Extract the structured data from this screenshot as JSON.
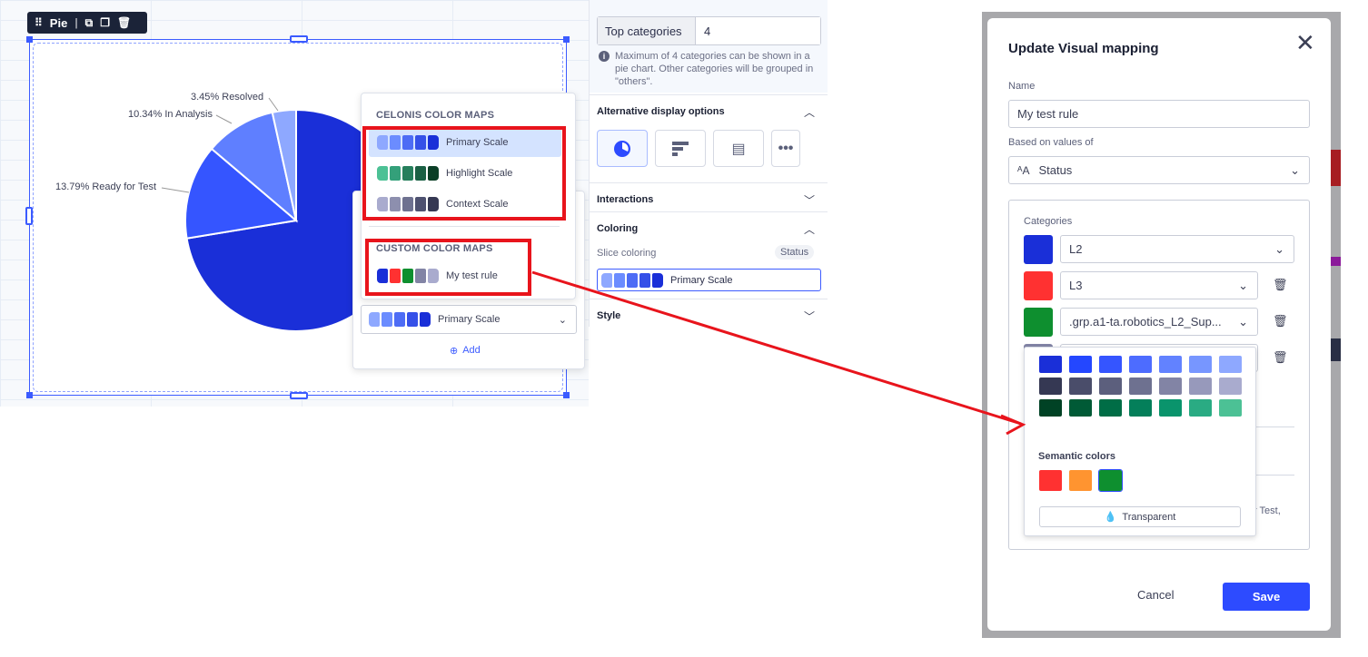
{
  "toolbar": {
    "title": "Pie",
    "icons": [
      "drag-handle-icon",
      "add-device-icon",
      "copy-icon",
      "trash-icon"
    ]
  },
  "chart_data": {
    "type": "pie",
    "slices": [
      {
        "label": "",
        "value": 72.41,
        "color": "#1a2fd8"
      },
      {
        "label": "13.79% Ready for Test",
        "value": 13.79,
        "color": "#3555ff"
      },
      {
        "label": "10.34% In Analysis",
        "value": 10.34,
        "color": "#5f7fff"
      },
      {
        "label": "3.45% Resolved",
        "value": 3.45,
        "color": "#8ea8ff"
      }
    ]
  },
  "color_maps": {
    "celonis_header": "CELONIS COLOR MAPS",
    "celonis": [
      {
        "name": "Primary Scale",
        "colors": [
          "#8ea8ff",
          "#6b8cff",
          "#4d6cf5",
          "#3550e8",
          "#1a2fd8"
        ],
        "selected": true
      },
      {
        "name": "Highlight Scale",
        "colors": [
          "#4cc195",
          "#34a07a",
          "#267f5c",
          "#1a6044",
          "#0b3f27"
        ]
      },
      {
        "name": "Context Scale",
        "colors": [
          "#a9abce",
          "#8d8fae",
          "#6e7190",
          "#4e5170",
          "#353853"
        ]
      }
    ],
    "custom_header": "CUSTOM COLOR MAPS",
    "custom": [
      {
        "name": "My test rule",
        "colors": [
          "#1a2fd8",
          "#ff3131",
          "#0e8f2f",
          "#8284a5",
          "#a9abce"
        ]
      }
    ],
    "current": {
      "name": "Primary Scale",
      "colors": [
        "#8ea8ff",
        "#6b8cff",
        "#4d6cf5",
        "#3550e8",
        "#1a2fd8"
      ]
    },
    "add_label": "Add"
  },
  "panel": {
    "top_categories_label": "Top categories",
    "top_categories_value": "4",
    "info": "Maximum of 4 categories can be shown in a pie chart. Other categories will be grouped in \"others\".",
    "alt_display": "Alternative display options",
    "interactions": "Interactions",
    "coloring": "Coloring",
    "slice_coloring": "Slice coloring",
    "slice_badge": "Status",
    "slice_map": "Primary Scale",
    "style": "Style"
  },
  "modal": {
    "title": "Update Visual mapping",
    "name_label": "Name",
    "name_value": "My test rule",
    "based_label": "Based on values of",
    "based_value": "Status",
    "categories_label": "Categories",
    "categories": [
      {
        "color": "#1a2fd8",
        "value": "L2"
      },
      {
        "color": "#ff3131",
        "value": "L3"
      },
      {
        "color": "#0e8f2f",
        "value": ".grp.a1-ta.robotics_L2_Sup..."
      },
      {
        "color": "#8284a5",
        "value": ""
      }
    ],
    "hidden_text": "r Test,",
    "cancel": "Cancel",
    "save": "Save",
    "accent": "#2d4bff"
  },
  "picker": {
    "rows": [
      [
        "#1a2fd8",
        "#2447ff",
        "#3555ff",
        "#4d6cff",
        "#6282ff",
        "#7796ff",
        "#8ea8ff"
      ],
      [
        "#353853",
        "#4a4d6a",
        "#5c5f7d",
        "#6e7190",
        "#8284a5",
        "#9799bb",
        "#a9abce"
      ],
      [
        "#004225",
        "#005a36",
        "#006d46",
        "#047f5a",
        "#0a946c",
        "#2aab83",
        "#4cc195"
      ]
    ],
    "semantic_label": "Semantic colors",
    "semantic": [
      "#ff3131",
      "#ff9430",
      "#0e8f2f"
    ],
    "transparent": "Transparent"
  }
}
